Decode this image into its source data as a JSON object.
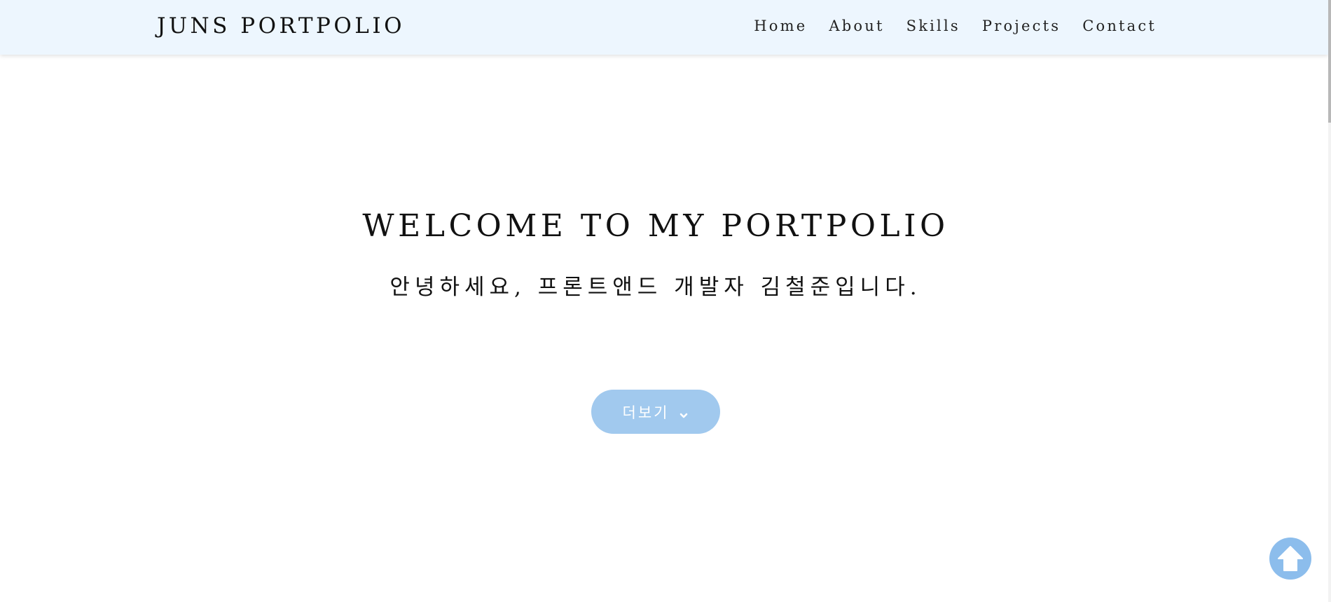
{
  "navbar": {
    "brand": "JUNS PORTPOLIO",
    "links": [
      {
        "label": "Home"
      },
      {
        "label": "About"
      },
      {
        "label": "Skills"
      },
      {
        "label": "Projects"
      },
      {
        "label": "Contact"
      }
    ],
    "background": "#edf6fe"
  },
  "hero": {
    "title": "WELCOME TO MY PORTPOLIO",
    "subtitle": "안녕하세요, 프론트앤드 개발자 김철준입니다.",
    "more_button": {
      "label": "더보기",
      "icon": "chevron-down-icon",
      "color": "#a1c9ee"
    }
  },
  "scroll_top": {
    "icon": "arrow-up-icon",
    "color": "#8cbdec"
  }
}
